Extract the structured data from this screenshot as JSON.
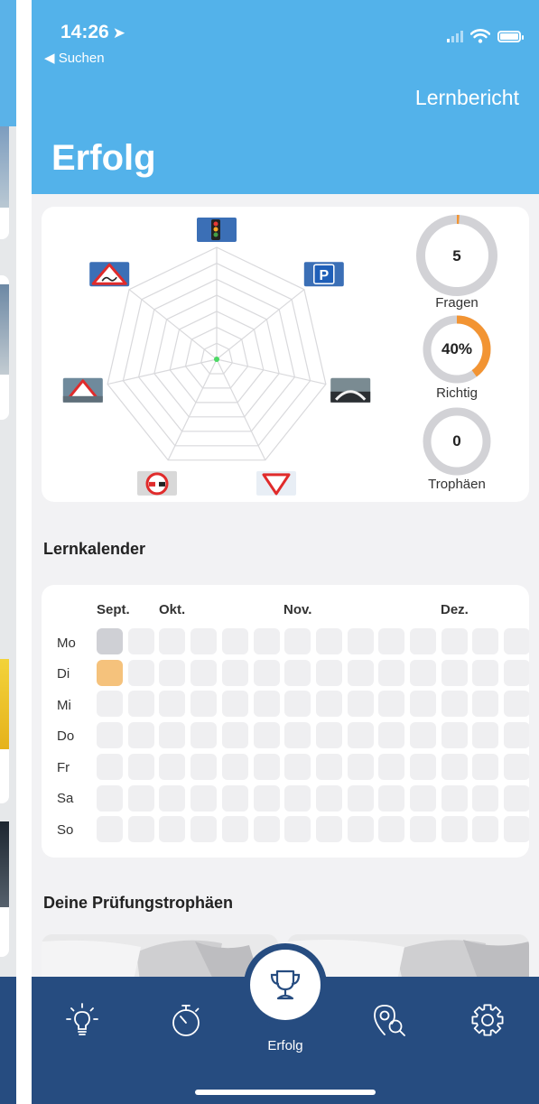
{
  "status_bar": {
    "time": "14:26",
    "back_label": "◀ Suchen"
  },
  "header": {
    "action_label": "Lernbericht",
    "title": "Erfolg"
  },
  "stats": {
    "questions": {
      "value": "5",
      "label": "Fragen",
      "progress": 0.01
    },
    "correct": {
      "value": "40%",
      "label": "Richtig",
      "progress": 0.4
    },
    "trophies": {
      "value": "0",
      "label": "Trophäen",
      "progress": 0
    }
  },
  "radar": {
    "categories": [
      "traffic-light-icon",
      "parking-sign-icon",
      "steering-wheel-icon",
      "yield-sign-icon",
      "no-overtaking-sign-icon",
      "warning-triangle-icon",
      "slippery-road-sign-icon"
    ],
    "values": [
      0,
      0,
      0,
      0,
      0,
      0,
      0
    ]
  },
  "calendar": {
    "title": "Lernkalender",
    "months": [
      "Sept.",
      "Okt.",
      "Nov.",
      "Dez."
    ],
    "days": [
      "Mo",
      "Di",
      "Mi",
      "Do",
      "Fr",
      "Sa",
      "So"
    ],
    "visited_cells": [
      {
        "week": 0,
        "day": 0
      }
    ],
    "active_cells": [
      {
        "week": 0,
        "day": 1
      }
    ]
  },
  "trophies_section": {
    "title": "Deine Prüfungstrophäen"
  },
  "nav": {
    "items": [
      "lightbulb-icon",
      "stopwatch-icon",
      "trophy-icon",
      "map-search-icon",
      "gear-icon"
    ],
    "active_label": "Erfolg"
  },
  "colors": {
    "header": "#53b2ea",
    "nav": "#264c80",
    "accent_orange": "#f29433",
    "ring_gray": "#d2d2d6",
    "active_cell": "#f5c27c"
  }
}
